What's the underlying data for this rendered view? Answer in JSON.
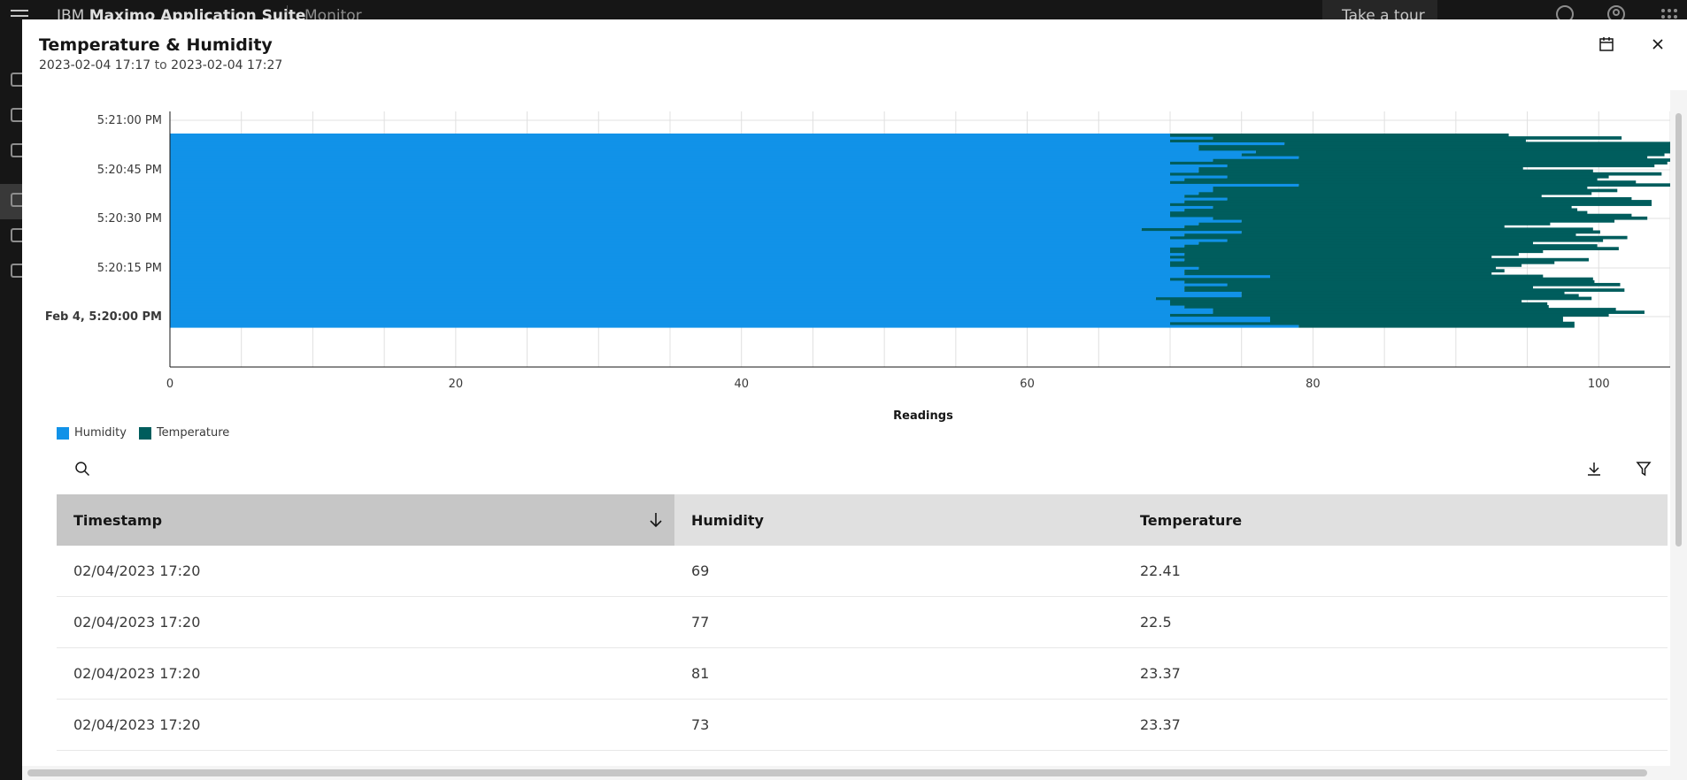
{
  "shell": {
    "app_name_prefix": "IBM",
    "app_name": "Maximo Application Suite",
    "section": "Monitor",
    "tour_label": "Take a tour"
  },
  "modal": {
    "title": "Temperature & Humidity",
    "range_start": "2023-02-04 17:17",
    "range_to": "to",
    "range_end": "2023-02-04 17:27"
  },
  "chart_data": {
    "type": "bar",
    "orientation": "horizontal",
    "stacked": true,
    "xlabel": "Readings",
    "xlim": [
      0,
      105
    ],
    "x_ticks": [
      0,
      20,
      40,
      60,
      80,
      100
    ],
    "y_ticks": [
      "Feb 4, 5:20:00 PM",
      "5:20:15 PM",
      "5:20:30 PM",
      "5:20:45 PM",
      "5:21:00 PM"
    ],
    "grid": true,
    "legend_position": "bottom-left",
    "series": [
      {
        "name": "Humidity",
        "color": "#1192e8",
        "values": [
          79,
          70,
          77,
          77,
          70,
          73,
          73,
          71,
          70,
          70,
          69,
          75,
          75,
          71,
          71,
          74,
          71,
          70,
          77,
          71,
          71,
          72,
          70,
          70,
          71,
          70,
          71,
          70,
          70,
          71,
          72,
          74,
          70,
          71,
          75,
          68,
          71,
          72,
          75,
          73,
          70,
          70,
          71,
          73,
          70,
          71,
          74,
          71,
          72,
          73,
          73,
          79,
          70,
          71,
          74,
          70,
          72,
          72,
          74,
          70,
          73,
          79,
          75,
          76,
          72,
          72,
          78,
          70,
          73,
          70
        ]
      },
      {
        "name": "Temperature",
        "color": "#005d5d",
        "values": [
          19.3,
          28.3,
          20.5,
          20.5,
          30.7,
          30.2,
          28.2,
          25.5,
          26.4,
          24.6,
          30.5,
          23.6,
          22.6,
          30.8,
          24.4,
          27.5,
          28.7,
          29.6,
          19.1,
          21.5,
          22.4,
          20.8,
          24.6,
          26.9,
          28.3,
          22.5,
          23.4,
          26.1,
          31.4,
          28.9,
          23.4,
          26.3,
          32.0,
          27.4,
          25.1,
          31.6,
          22.4,
          24.6,
          26.1,
          30.4,
          32.3,
          29.2,
          27.5,
          25.1,
          33.7,
          32.7,
          28.3,
          25.0,
          27.5,
          28.3,
          26.2,
          27.6,
          32.6,
          28.9,
          26.7,
          34.4,
          27.6,
          22.7,
          29.9,
          34.8,
          32.2,
          24.4,
          29.6,
          31.2,
          35.4,
          34.7,
          28.8,
          24.9,
          28.6,
          23.7
        ]
      }
    ]
  },
  "table": {
    "columns": [
      "Timestamp",
      "Humidity",
      "Temperature"
    ],
    "rows": [
      [
        "02/04/2023 17:20",
        "69",
        "22.41"
      ],
      [
        "02/04/2023 17:20",
        "77",
        "22.5"
      ],
      [
        "02/04/2023 17:20",
        "81",
        "23.37"
      ],
      [
        "02/04/2023 17:20",
        "73",
        "23.37"
      ]
    ]
  },
  "icons": {
    "calendar": "calendar-icon",
    "close": "close-icon",
    "search": "search-icon",
    "download": "download-icon",
    "filter": "filter-icon",
    "sort": "arrow-down-icon"
  },
  "colors": {
    "humidity": "#1192e8",
    "temperature": "#005d5d"
  }
}
